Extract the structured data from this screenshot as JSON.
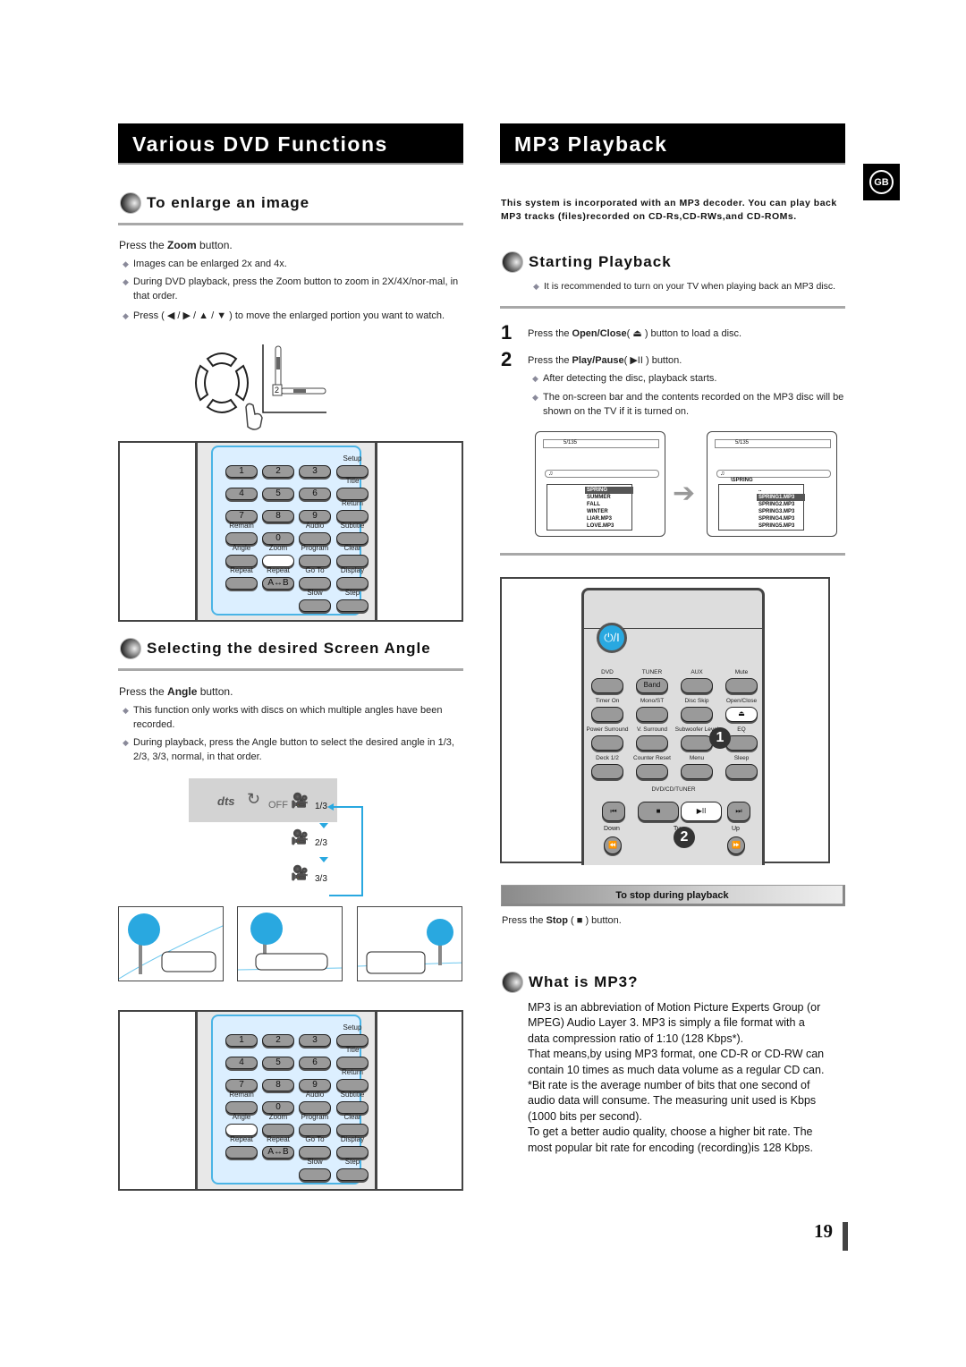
{
  "left": {
    "title": "Various DVD Functions",
    "enlarge": {
      "heading": "To enlarge an image",
      "press_prefix": "Press the ",
      "press_bold": "Zoom",
      "press_suffix": " button.",
      "bullets": [
        "Images can be enlarged 2x and 4x.",
        "During DVD playback, press the Zoom button to zoom in 2X/4X/nor-mal, in that order.",
        "Press ( ◀ / ▶ / ▲ / ▼ ) to move the enlarged portion you want to watch."
      ],
      "zoom_indicator": "2"
    },
    "keypad": {
      "buttons": [
        "1",
        "2",
        "3",
        "4",
        "5",
        "6",
        "7",
        "8",
        "9",
        "0",
        "A↔B"
      ],
      "labels": [
        "Setup",
        "Title",
        "Return",
        "Remain",
        "Audio",
        "Subtitle",
        "Angle",
        "Zoom",
        "Program",
        "Clear",
        "Repeat",
        "Repeat",
        "Go To",
        "Display",
        "Slow",
        "Step"
      ]
    },
    "angle": {
      "heading": "Selecting the desired Screen Angle",
      "press_prefix": "Press the ",
      "press_bold": "Angle",
      "press_suffix": " button.",
      "bullets": [
        "This function only works with discs on which multiple angles have been recorded.",
        "During playback, press the Angle button to select the desired angle in 1/3, 2/3, 3/3, normal, in that order."
      ],
      "osd": {
        "dts": "dts",
        "repeat": "OFF",
        "angles": [
          "1/3",
          "2/3",
          "3/3"
        ]
      }
    }
  },
  "right": {
    "title": "MP3 Playback",
    "badge": "GB",
    "intro": "This system is incorporated with an MP3 decoder. You can play back MP3 tracks (files)recorded on CD-Rs,CD-RWs,and CD-ROMs.",
    "starting": {
      "heading": "Starting Playback",
      "note": "It is recommended to turn on your TV when playing back an MP3 disc.",
      "steps": [
        {
          "num": "1",
          "prefix": "Press the ",
          "bold": "Open/Close",
          "icon": "( ⏏ )",
          "suffix": " button to load a disc."
        },
        {
          "num": "2",
          "prefix": "Press the ",
          "bold": "Play/Pause",
          "icon": "( ▶II )",
          "suffix": " button."
        }
      ],
      "bullets": [
        "After detecting the disc, playback starts.",
        "The on-screen bar and the contents recorded on the MP3 disc will be shown on the TV if it is turned on."
      ]
    },
    "screens": [
      {
        "track": "5/135",
        "folder": "",
        "rows": [
          "SPRING",
          "SUMMER",
          "FALL",
          "WINTER",
          "LIAR.MP3",
          "LOVE.MP3"
        ],
        "selected": 0
      },
      {
        "track": "5/135",
        "folder": "\\SPRING",
        "rows": [
          "..",
          "SPRING1.MP3",
          "SPRING2.MP3",
          "SPRING3.MP3",
          "SPRING4.MP3",
          "SPRING5.MP3"
        ],
        "selected": 1
      }
    ],
    "remote": {
      "power": "⏻/I",
      "row1_labels": [
        "DVD",
        "TUNER",
        "AUX",
        "Mute"
      ],
      "band": "Band",
      "row2_labels": [
        "Timer On",
        "Mono/ST",
        "Disc Skip",
        "Open/Close"
      ],
      "row3_labels": [
        "Power Surround",
        "V. Surround",
        "Subwoofer Level",
        "EQ"
      ],
      "row4_labels": [
        "Deck 1/2",
        "Counter Reset",
        "Menu",
        "Sleep"
      ],
      "group_label": "DVD/CD/TUNER",
      "down": "Down",
      "tuning": "Tu",
      "up": "Up",
      "callouts": [
        "1",
        "2"
      ]
    },
    "stop": {
      "bar": "To stop during playback",
      "prefix": "Press the ",
      "bold": "Stop",
      "icon": " ( ■ )",
      "suffix": " button."
    },
    "what": {
      "heading": "What is MP3?",
      "lines": [
        "MP3 is an abbreviation of Motion Picture Experts Group (or",
        "MPEG) Audio Layer 3. MP3 is simply a file format with a",
        "data compression ratio of 1:10 (128 Kbps*).",
        "That means,by using MP3 format, one CD-R or CD-RW can",
        "contain 10 times as much data volume as a regular CD can.",
        "*Bit rate is the average number of bits that one second of",
        "audio data will consume. The measuring unit used is Kbps",
        "(1000 bits per second).",
        "To get a better audio quality, choose a higher bit rate. The",
        "most popular bit rate for encoding (recording)is 128 Kbps."
      ]
    }
  },
  "page_number": "19",
  "colors": {
    "accent_blue": "#29a8e0",
    "keypad_bg": "#dcefff"
  }
}
